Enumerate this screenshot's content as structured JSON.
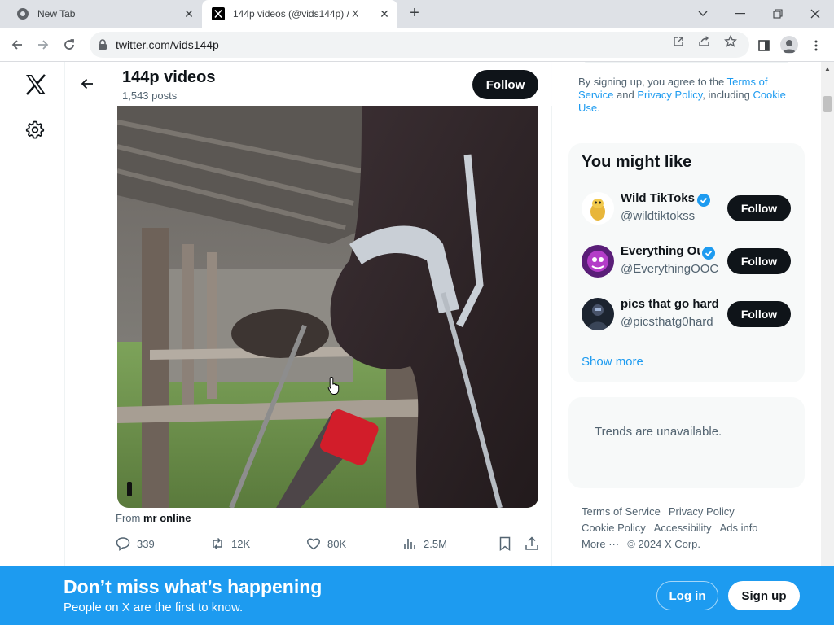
{
  "browser": {
    "tabs": [
      {
        "title": "New Tab"
      },
      {
        "title": "144p videos (@vids144p) / X"
      }
    ],
    "url": "twitter.com/vids144p"
  },
  "profile": {
    "name": "144p videos",
    "posts_count": "1,543 posts",
    "follow_label": "Follow"
  },
  "post": {
    "from_prefix": "From",
    "from_source": "mr online",
    "replies": "339",
    "reposts": "12K",
    "likes": "80K",
    "views": "2.5M"
  },
  "sidebar": {
    "legal": {
      "prefix": "By signing up, you agree to the",
      "terms": "Terms of Service",
      "and": "and",
      "privacy": "Privacy Policy",
      "including": ", including",
      "cookie": "Cookie Use",
      "end": "."
    },
    "might_like_title": "You might like",
    "suggestions": [
      {
        "name": "Wild TikToks",
        "handle": "@wildtiktokss",
        "verified": true,
        "follow": "Follow"
      },
      {
        "name": "Everything Out of Context",
        "handle": "@EverythingOOC",
        "verified": true,
        "follow": "Follow"
      },
      {
        "name": "pics that go hard",
        "handle": "@picsthatg0hard",
        "verified": false,
        "follow": "Follow"
      }
    ],
    "show_more": "Show more",
    "trends_msg": "Trends are unavailable.",
    "footer": [
      "Terms of Service",
      "Privacy Policy",
      "Cookie Policy",
      "Accessibility",
      "Ads info",
      "More ···",
      "© 2024 X Corp."
    ]
  },
  "banner": {
    "title": "Don’t miss what’s happening",
    "subtitle": "People on X are the first to know.",
    "login": "Log in",
    "signup": "Sign up"
  },
  "colors": {
    "accent": "#1d9bf0",
    "text": "#0f1419",
    "muted": "#536471"
  }
}
